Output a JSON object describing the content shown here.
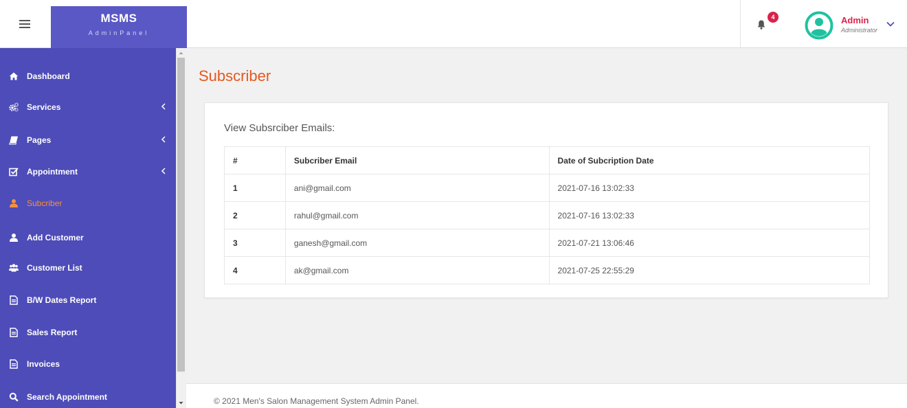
{
  "brand": {
    "name": "MSMS",
    "sub": "AdminPanel"
  },
  "notifications": {
    "count": "4"
  },
  "user": {
    "name": "Admin",
    "role": "Administrator"
  },
  "sidebar": {
    "items": [
      {
        "label": "Dashboard",
        "icon": "home-icon"
      },
      {
        "label": "Services",
        "icon": "gears-icon"
      },
      {
        "label": "Pages",
        "icon": "book-icon"
      },
      {
        "label": "Appointment",
        "icon": "checkbox-icon"
      },
      {
        "label": "Subcriber",
        "icon": "user-icon"
      },
      {
        "label": "Add Customer",
        "icon": "user-icon"
      },
      {
        "label": "Customer List",
        "icon": "users-icon"
      },
      {
        "label": "B/W Dates Report",
        "icon": "file-icon"
      },
      {
        "label": "Sales Report",
        "icon": "file-icon"
      },
      {
        "label": "Invoices",
        "icon": "file-icon"
      },
      {
        "label": "Search Appointment",
        "icon": "search-icon"
      }
    ]
  },
  "page": {
    "title": "Subscriber"
  },
  "card": {
    "title": "View Subsrciber Emails:"
  },
  "table": {
    "headers": [
      "#",
      "Subcriber Email",
      "Date of Subcription Date"
    ],
    "rows": [
      [
        "1",
        "ani@gmail.com",
        "2021-07-16 13:02:33"
      ],
      [
        "2",
        "rahul@gmail.com",
        "2021-07-16 13:02:33"
      ],
      [
        "3",
        "ganesh@gmail.com",
        "2021-07-21 13:06:46"
      ],
      [
        "4",
        "ak@gmail.com",
        "2021-07-25 22:55:29"
      ]
    ]
  },
  "footer": {
    "text": "© 2021 Men's Salon Management System Admin Panel."
  },
  "colors": {
    "sidebar": "#4e4cb8",
    "brand": "#5a58c4",
    "accent": "#e4581f",
    "active": "#f6913d",
    "badge": "#d9234b",
    "avatar": "#1fc2a0"
  }
}
